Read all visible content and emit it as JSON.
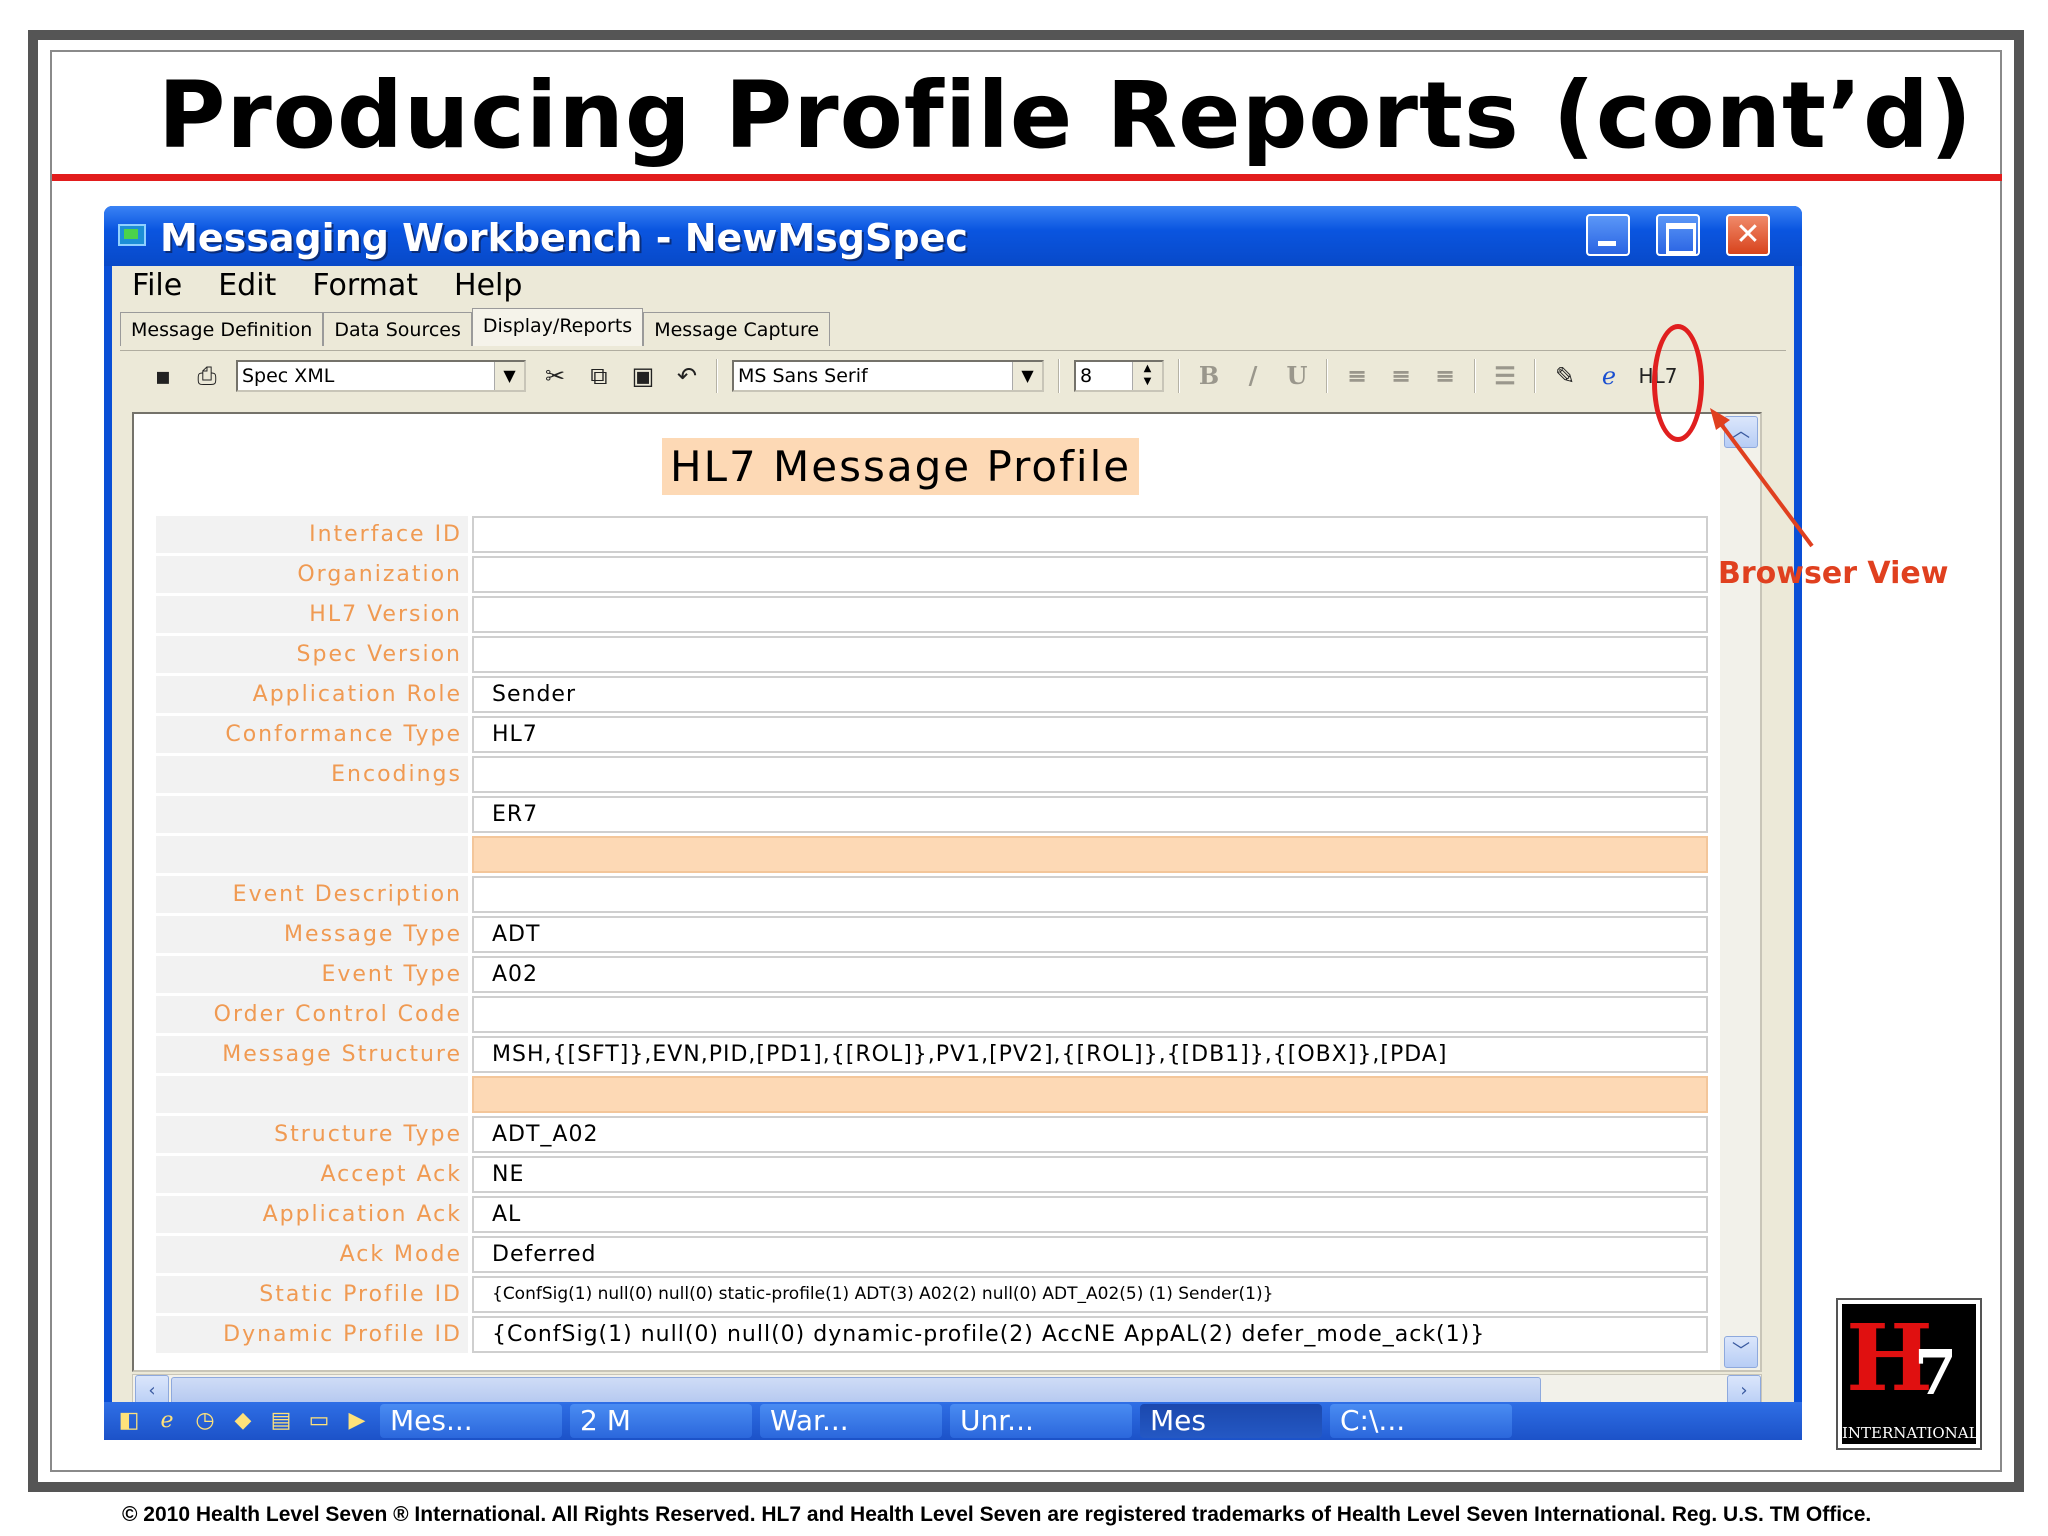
{
  "slide": {
    "title": "Producing Profile Reports (cont’d)",
    "footer": "© 2010 Health Level Seven ® International. All Rights Reserved. HL7 and Health Level Seven are registered trademarks of Health Level Seven International. Reg. U.S. TM Office.",
    "annotation": "Browser View",
    "logo_text": "INTERNATIONAL",
    "accent_color": "#e21d1d"
  },
  "window": {
    "title": "Messaging Workbench - NewMsgSpec",
    "menu": [
      "File",
      "Edit",
      "Format",
      "Help"
    ],
    "tabs": [
      "Message Definition",
      "Data Sources",
      "Display/Reports",
      "Message Capture"
    ],
    "active_tab": "Display/Reports",
    "toolbar": {
      "view_select": "Spec XML",
      "font_select": "MS Sans Serif",
      "font_size": "8",
      "icons": [
        "save-icon",
        "print-icon",
        "cut-icon",
        "copy-icon",
        "paste-icon",
        "undo-icon",
        "bold-icon",
        "italic-icon",
        "underline-icon",
        "align-left-icon",
        "align-center-icon",
        "align-right-icon",
        "bullets-icon",
        "highlighter-icon",
        "browser-view-icon",
        "hl7-icon"
      ],
      "hl7_label": "HL7"
    }
  },
  "report": {
    "heading": "HL7 Message Profile",
    "rows": [
      {
        "label": "Interface ID",
        "value": ""
      },
      {
        "label": "Organization",
        "value": ""
      },
      {
        "label": "HL7 Version",
        "value": ""
      },
      {
        "label": "Spec Version",
        "value": ""
      },
      {
        "label": "Application Role",
        "value": "Sender"
      },
      {
        "label": "Conformance Type",
        "value": "HL7"
      },
      {
        "label": "Encodings",
        "value": ""
      },
      {
        "label": "",
        "value": "ER7"
      },
      {
        "label": "",
        "value": ""
      },
      {
        "label": "Event Description",
        "value": ""
      },
      {
        "label": "Message Type",
        "value": "ADT"
      },
      {
        "label": "Event Type",
        "value": "A02"
      },
      {
        "label": "Order Control Code",
        "value": ""
      },
      {
        "label": "Message Structure",
        "value": "MSH,{[SFT]},EVN,PID,[PD1],{[ROL]},PV1,[PV2],{[ROL]},{[DB1]},{[OBX]},[PDA]"
      },
      {
        "label": "",
        "value": ""
      },
      {
        "label": "Structure Type",
        "value": "ADT_A02"
      },
      {
        "label": "Accept Ack",
        "value": "NE"
      },
      {
        "label": "Application Ack",
        "value": "AL"
      },
      {
        "label": "Ack Mode",
        "value": "Deferred"
      },
      {
        "label": "Static Profile ID",
        "value": "{ConfSig(1) null(0) null(0) static-profile(1) ADT(3) A02(2) null(0) ADT_A02(5) (1) Sender(1)}"
      },
      {
        "label": "Dynamic Profile ID",
        "value": "{ConfSig(1) null(0) null(0) dynamic-profile(2) AccNE AppAL(2) defer_mode_ack(1)}"
      }
    ],
    "label_color": "#f09a52",
    "highlight_color": "#fdd9b5"
  },
  "taskbar": {
    "buttons": [
      "Mes...",
      "2 M",
      "War...",
      "Unr...",
      "Mes",
      "C:\\..."
    ],
    "active": "Mes"
  }
}
